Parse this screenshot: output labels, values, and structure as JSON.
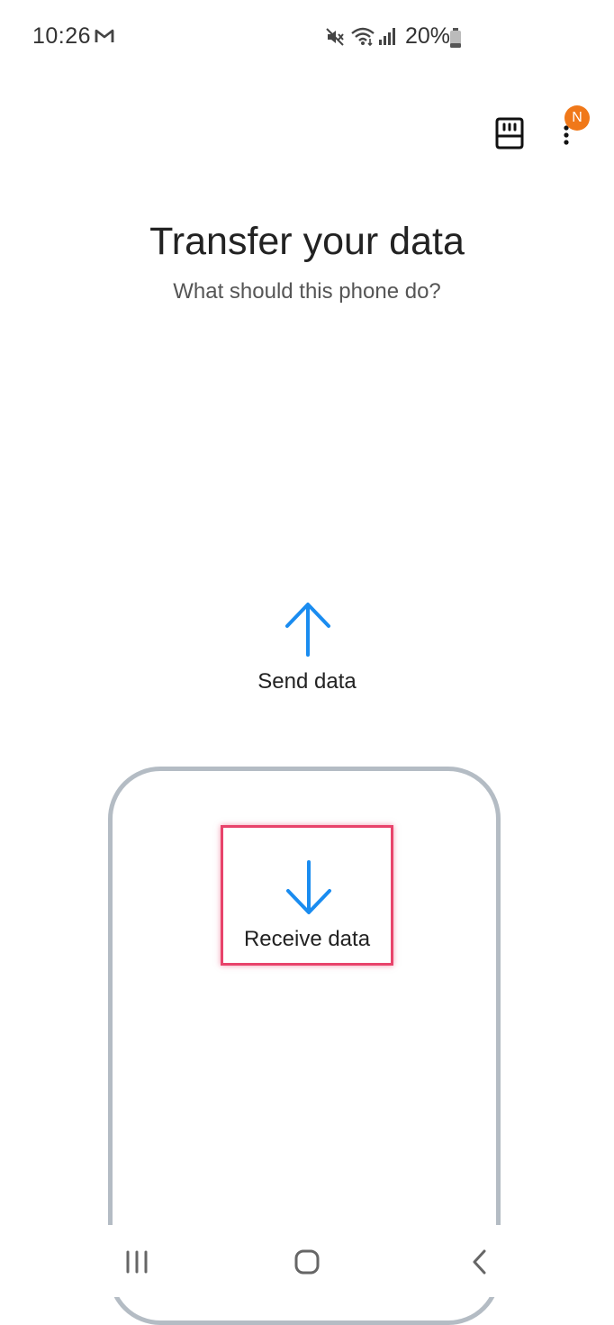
{
  "status_bar": {
    "time": "10:26",
    "mail_icon": "gmail-icon",
    "icons": [
      "mute-icon",
      "wifi-icon",
      "signal-icon"
    ],
    "battery_text": "20%",
    "battery_icon": "battery-icon"
  },
  "top_actions": {
    "sd_card_icon": "sd-card-icon",
    "more_icon": "more-vertical-icon",
    "badge_text": "N",
    "badge_color": "#f07819"
  },
  "header": {
    "title": "Transfer your data",
    "subtitle": "What should this phone do?"
  },
  "options": {
    "send": {
      "label": "Send data",
      "icon": "arrow-up-icon"
    },
    "receive": {
      "label": "Receive data",
      "icon": "arrow-down-icon"
    }
  },
  "colors": {
    "accent": "#1a8cf0",
    "highlight": "#e8436b",
    "frame": "#b4bcc4"
  },
  "nav_bar": {
    "icons": [
      "recents-icon",
      "home-icon",
      "back-icon"
    ]
  }
}
